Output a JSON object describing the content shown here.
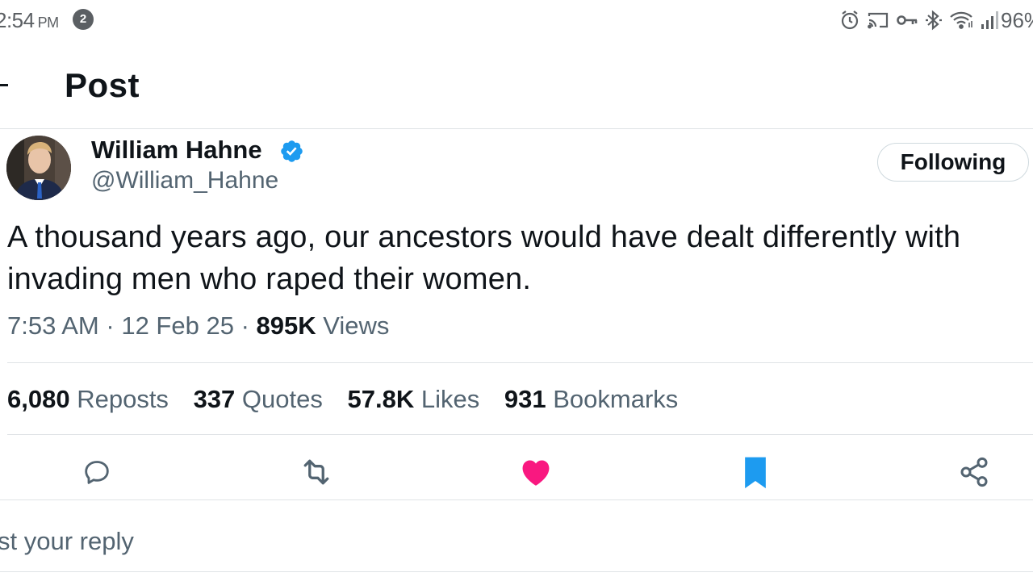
{
  "status_bar": {
    "time": "2:54",
    "ampm": "PM",
    "notification_count": "2",
    "battery": "96%"
  },
  "header": {
    "title": "Post"
  },
  "post": {
    "author": {
      "display_name": "William Hahne",
      "handle": "@William_Hahne",
      "verified": true
    },
    "follow_button": "Following",
    "text": "A thousand years ago, our ancestors would have dealt differently with invading men who raped their women.",
    "time": "7:53 AM",
    "date": "12 Feb 25",
    "views_count": "895K",
    "views_label": "Views",
    "separator": "·",
    "stats": [
      {
        "count": "6,080",
        "label": "Reposts"
      },
      {
        "count": "337",
        "label": "Quotes"
      },
      {
        "count": "57.8K",
        "label": "Likes"
      },
      {
        "count": "931",
        "label": "Bookmarks"
      }
    ],
    "actions": [
      {
        "name": "reply",
        "icon": "speech-bubble-icon"
      },
      {
        "name": "repost",
        "icon": "repost-arrows-icon"
      },
      {
        "name": "like",
        "icon": "heart-icon",
        "active": true,
        "color": "#f91880"
      },
      {
        "name": "bookmark",
        "icon": "bookmark-icon",
        "active": true,
        "color": "#1d9bf0"
      },
      {
        "name": "share",
        "icon": "share-icon"
      }
    ]
  },
  "reply_box": {
    "placeholder": "st your reply"
  },
  "colors": {
    "accent": "#1d9bf0",
    "like": "#f91880",
    "text": "#0f1419",
    "secondary_text": "#536471"
  }
}
